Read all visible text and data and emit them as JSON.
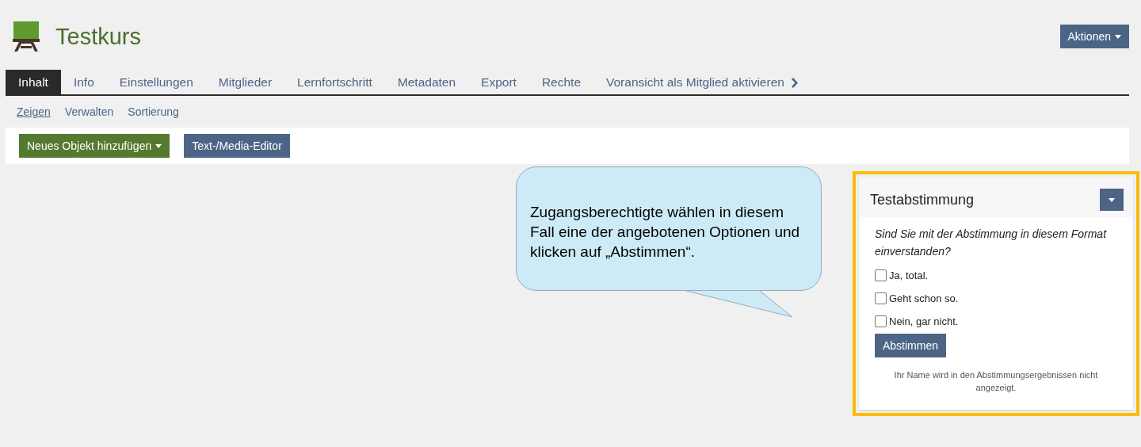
{
  "header": {
    "title": "Testkurs",
    "actions_button": "Aktionen"
  },
  "tabs": [
    {
      "label": "Inhalt",
      "selected": true
    },
    {
      "label": "Info",
      "selected": false
    },
    {
      "label": "Einstellungen",
      "selected": false
    },
    {
      "label": "Mitglieder",
      "selected": false
    },
    {
      "label": "Lernfortschritt",
      "selected": false
    },
    {
      "label": "Metadaten",
      "selected": false
    },
    {
      "label": "Export",
      "selected": false
    },
    {
      "label": "Rechte",
      "selected": false
    },
    {
      "label": "Voransicht als Mitglied aktivieren",
      "selected": false
    }
  ],
  "subtabs": [
    {
      "label": "Zeigen",
      "selected": true
    },
    {
      "label": "Verwalten",
      "selected": false
    },
    {
      "label": "Sortierung",
      "selected": false
    }
  ],
  "toolbar": {
    "add_button": "Neues Objekt hinzufügen",
    "editor_button": "Text-/Media-Editor"
  },
  "callout": {
    "text": "Zugangsberechtigte wählen in diesem Fall eine der angebotenen Optionen und klicken auf „Abstimmen“."
  },
  "poll": {
    "title": "Testabstimmung",
    "highlighted": true,
    "question": "Sind Sie mit der Abstimmung in diesem Format einverstanden?",
    "options": [
      {
        "label": "Ja, total.",
        "checked": false
      },
      {
        "label": "Geht schon so.",
        "checked": false
      },
      {
        "label": "Nein, gar nicht.",
        "checked": false
      }
    ],
    "vote_button": "Abstimmen",
    "note": "Ihr Name wird in den Abstimmungsergebnissen nicht angezeigt."
  }
}
